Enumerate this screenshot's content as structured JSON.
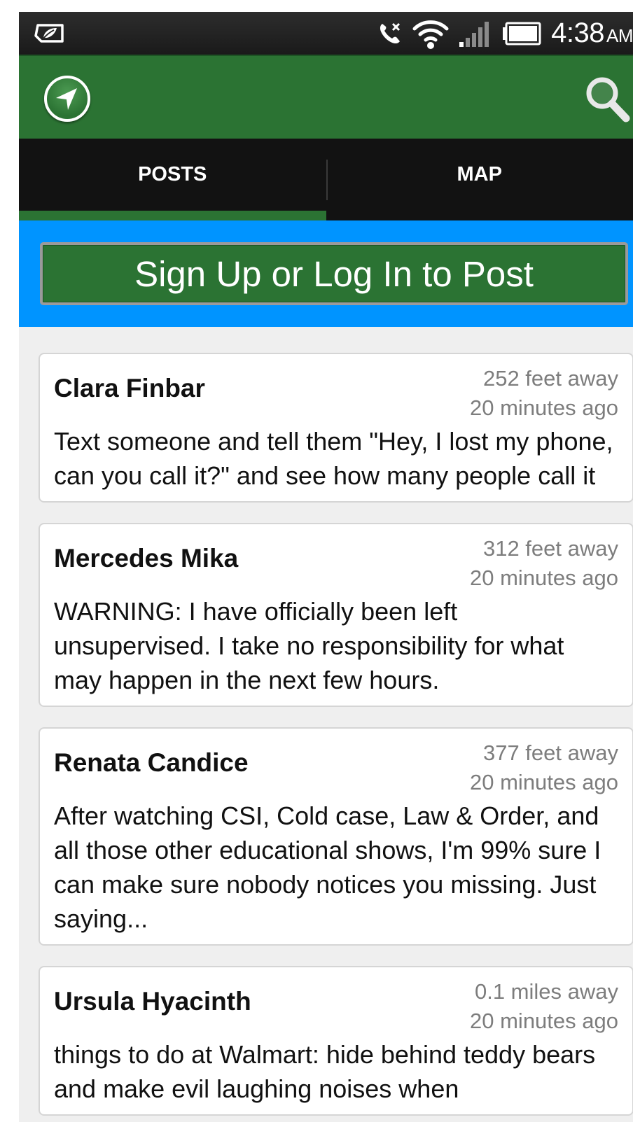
{
  "status_bar": {
    "time": "4:38",
    "ampm": "AM",
    "icons": [
      "leaf-icon",
      "muted-call-icon",
      "wifi-icon",
      "signal-icon",
      "battery-icon"
    ]
  },
  "action_bar": {
    "icons": [
      "navigation-arrow-icon",
      "search-icon"
    ]
  },
  "tabs": [
    {
      "label": "POSTS",
      "selected": true
    },
    {
      "label": "MAP",
      "selected": false
    }
  ],
  "signup": {
    "label": "Sign Up or Log In to Post"
  },
  "posts": [
    {
      "author": "Clara Finbar",
      "distance": "252 feet away",
      "time": "20 minutes ago",
      "body": "Text someone and tell them \"Hey, I lost my phone, can you call it?\" and see how many people call it"
    },
    {
      "author": "Mercedes Mika",
      "distance": "312 feet away",
      "time": "20 minutes ago",
      "body": "WARNING: I have officially been left unsupervised. I take no responsibility for what may happen in the next few hours."
    },
    {
      "author": "Renata Candice",
      "distance": "377 feet away",
      "time": "20 minutes ago",
      "body": "After watching CSI, Cold case, Law & Order, and all those other educational shows, I'm 99% sure I can make sure nobody notices you missing. Just saying..."
    },
    {
      "author": "Ursula Hyacinth",
      "distance": "0.1 miles away",
      "time": "20 minutes ago",
      "body": "things to do at Walmart: hide behind teddy bears and make evil laughing noises when"
    }
  ],
  "colors": {
    "action_bar": "#2b7333",
    "tabs_bg": "#121212",
    "signup_band": "#0094ff",
    "list_bg": "#efefef"
  }
}
